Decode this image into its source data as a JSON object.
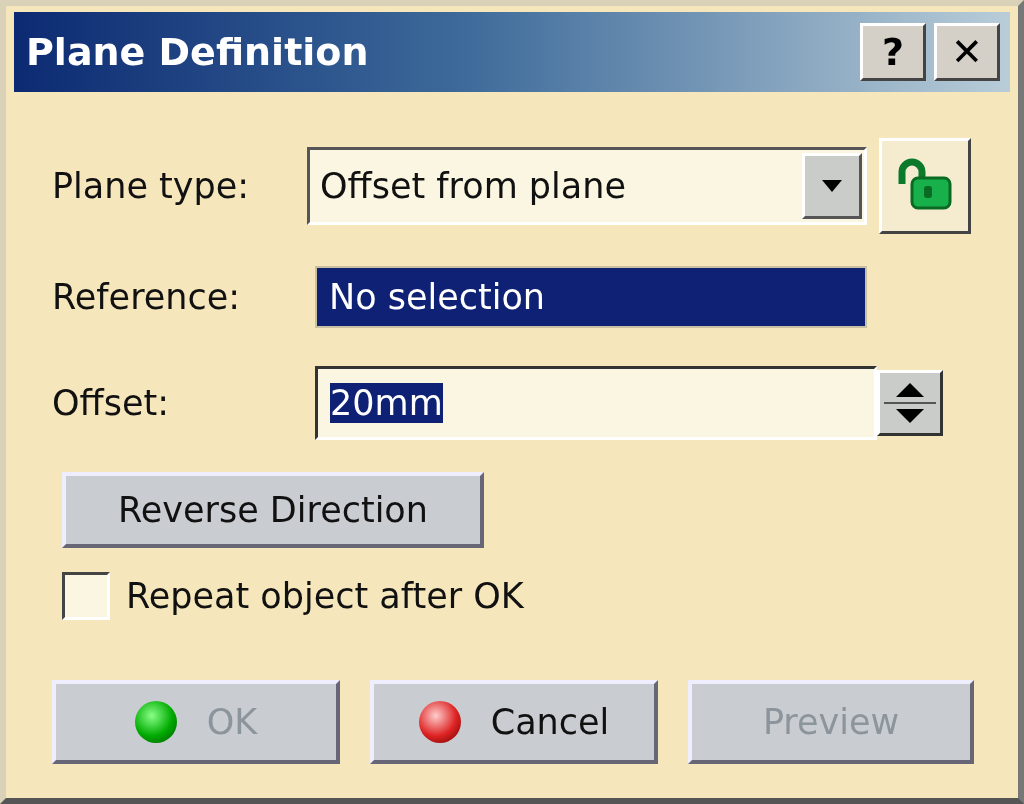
{
  "window": {
    "title": "Plane Definition",
    "title_buttons": [
      {
        "label": "?"
      },
      {
        "label": "✕"
      }
    ]
  },
  "plane_type": {
    "label": "Plane type:",
    "value": "Offset from plane"
  },
  "reference": {
    "label": "Reference:",
    "value": "No selection",
    "selected": true
  },
  "offset": {
    "label": "Offset:",
    "value": "20mm",
    "selected": true
  },
  "reverse_button": {
    "label": "Reverse Direction"
  },
  "repeat": {
    "label": "Repeat object after OK",
    "checked": false
  },
  "buttons": [
    {
      "label": "OK",
      "kind": "ok",
      "disabled": true
    },
    {
      "label": "Cancel",
      "kind": "cancel",
      "disabled": false
    },
    {
      "label": "Preview",
      "kind": "plain",
      "disabled": true
    }
  ]
}
